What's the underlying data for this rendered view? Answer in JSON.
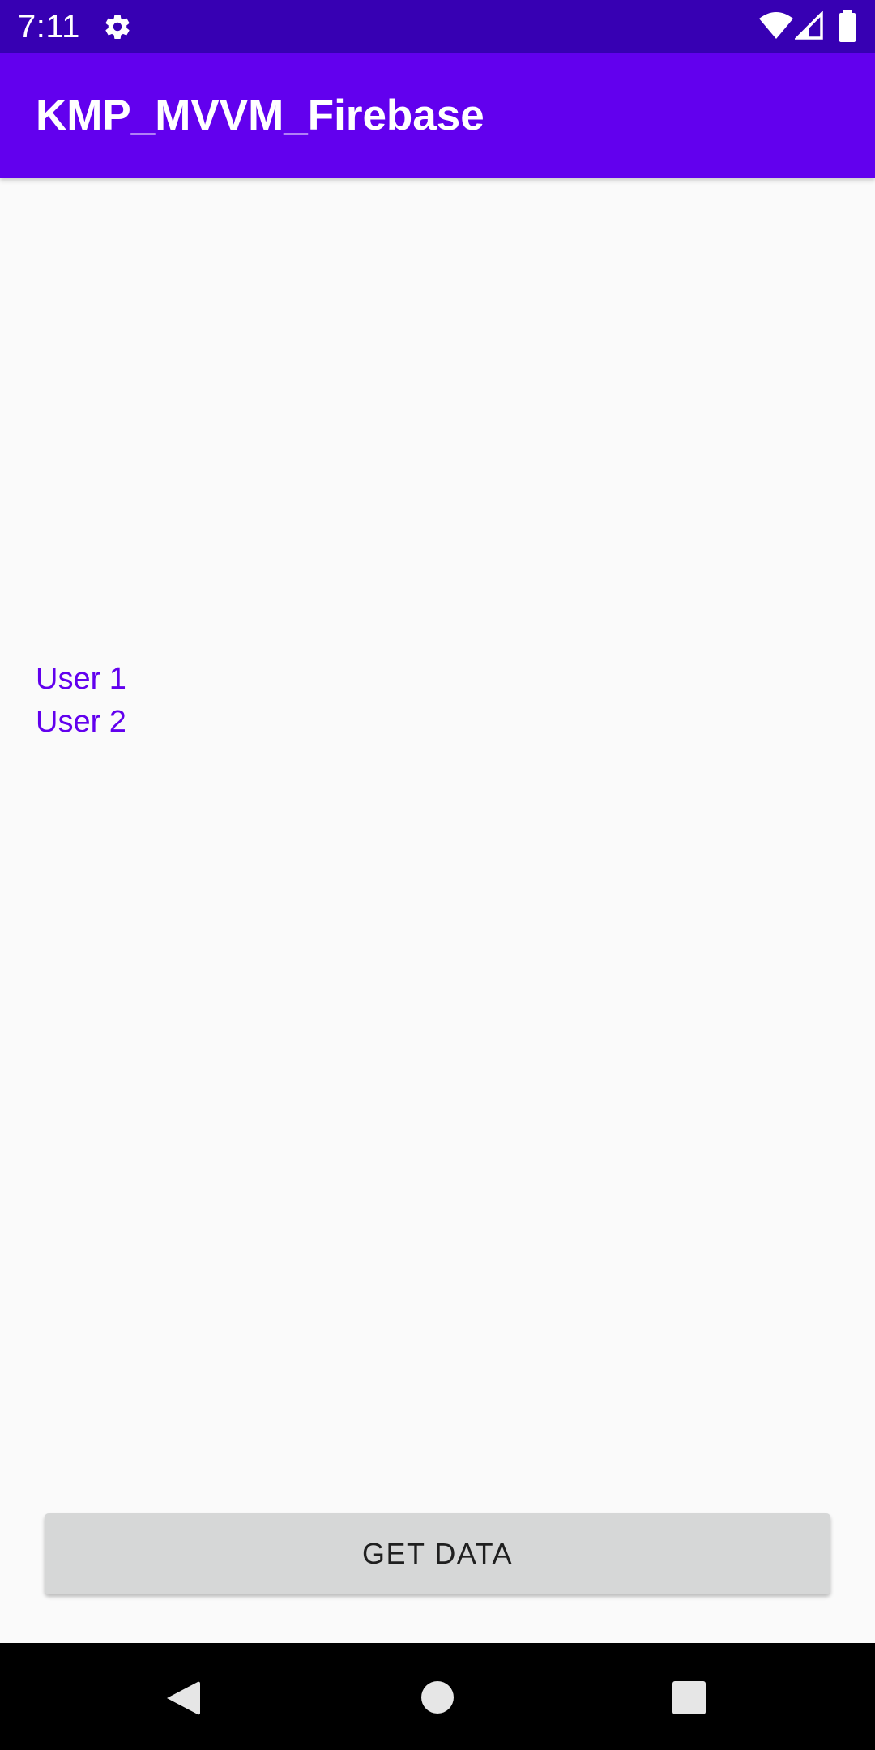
{
  "status_bar": {
    "time": "7:11",
    "icons": [
      "gear-icon",
      "wifi-icon",
      "signal-icon",
      "battery-icon"
    ]
  },
  "app_bar": {
    "title": "KMP_MVVM_Firebase",
    "color": "#6200ee"
  },
  "users": [
    {
      "name": "User 1"
    },
    {
      "name": "User 2"
    }
  ],
  "actions": {
    "get_data_label": "GET DATA"
  },
  "navigation": {
    "icons": [
      "back-icon",
      "home-icon",
      "recents-icon"
    ]
  },
  "colors": {
    "status_bar": "#3700b3",
    "primary": "#6200ee",
    "background": "#fafafa",
    "button": "#d6d7d7",
    "nav_bar": "#000000"
  }
}
